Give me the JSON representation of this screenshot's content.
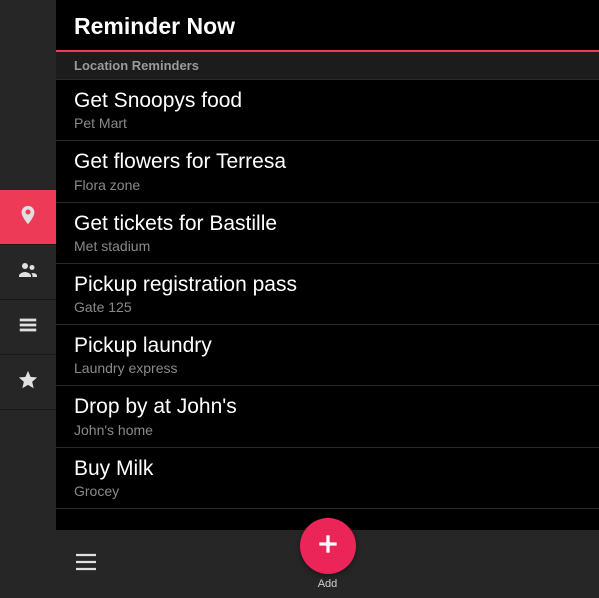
{
  "header": {
    "title": "Reminder Now"
  },
  "section": {
    "label": "Location Reminders"
  },
  "sidebar": {
    "items": [
      {
        "name": "location-pin-icon",
        "active": true
      },
      {
        "name": "people-icon",
        "active": false
      },
      {
        "name": "list-icon",
        "active": false
      },
      {
        "name": "star-icon",
        "active": false
      }
    ]
  },
  "reminders": [
    {
      "title": "Get Snoopys food",
      "sub": "Pet Mart"
    },
    {
      "title": "Get flowers for Terresa",
      "sub": "Flora zone"
    },
    {
      "title": "Get tickets for Bastille",
      "sub": "Met stadium"
    },
    {
      "title": "Pickup registration pass",
      "sub": "Gate 125"
    },
    {
      "title": "Pickup laundry",
      "sub": "Laundry express"
    },
    {
      "title": "Drop by at John's",
      "sub": "John's home"
    },
    {
      "title": "Buy Milk",
      "sub": "Grocey"
    }
  ],
  "bottom": {
    "add_label": "Add"
  },
  "colors": {
    "accent": "#ec3a57",
    "fab": "#ec2558",
    "bg": "#000",
    "chrome": "#262626"
  }
}
